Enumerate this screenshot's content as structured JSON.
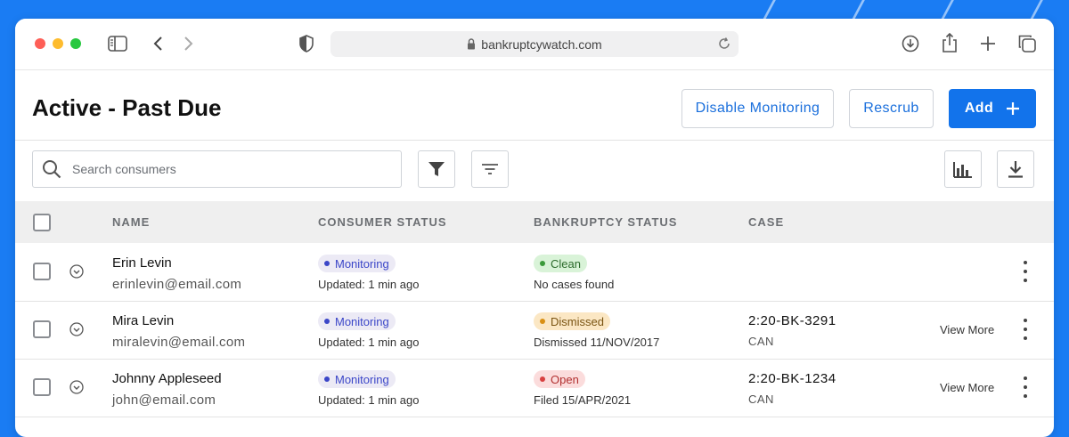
{
  "browser": {
    "url": "bankruptcywatch.com"
  },
  "page": {
    "title": "Active - Past Due",
    "buttons": {
      "disable_monitoring": "Disable Monitoring",
      "rescrub": "Rescrub",
      "add": "Add"
    },
    "search": {
      "placeholder": "Search consumers",
      "value": ""
    }
  },
  "table": {
    "headers": {
      "name": "NAME",
      "consumer_status": "CONSUMER STATUS",
      "bankruptcy_status": "BANKRUPTCY STATUS",
      "case": "CASE"
    },
    "rows": [
      {
        "name": "Erin Levin",
        "email": "erinlevin@email.com",
        "consumer_status": "Monitoring",
        "consumer_updated": "Updated: 1 min ago",
        "bankruptcy_status": "Clean",
        "bankruptcy_detail": "No cases found",
        "case_number": "",
        "case_type": "",
        "view_more": ""
      },
      {
        "name": "Mira Levin",
        "email": "miralevin@email.com",
        "consumer_status": "Monitoring",
        "consumer_updated": "Updated: 1 min ago",
        "bankruptcy_status": "Dismissed",
        "bankruptcy_detail": "Dismissed 11/NOV/2017",
        "case_number": "2:20-BK-3291",
        "case_type": "CAN",
        "view_more": "View More"
      },
      {
        "name": "Johnny Appleseed",
        "email": "john@email.com",
        "consumer_status": "Monitoring",
        "consumer_updated": "Updated: 1 min ago",
        "bankruptcy_status": "Open",
        "bankruptcy_detail": "Filed 15/APR/2021",
        "case_number": "2:20-BK-1234",
        "case_type": "CAN",
        "view_more": "View More"
      }
    ]
  },
  "colors": {
    "background": "#1a7cf3",
    "primary": "#1273eb",
    "monitoring_bg": "#eceaf5",
    "monitoring_text": "#3b46c8",
    "clean_bg": "#d9f3d8",
    "clean_text": "#2c6b2c",
    "dismissed_bg": "#fbe7c4",
    "dismissed_text": "#7a5412",
    "open_bg": "#fbdcdc",
    "open_text": "#b23030"
  },
  "icons": [
    "sidebar-icon",
    "back-icon",
    "forward-icon",
    "shield-icon",
    "lock-icon",
    "reload-icon",
    "download-icon",
    "share-icon",
    "new-tab-icon",
    "tabs-icon",
    "search-icon",
    "filter-icon",
    "sort-icon",
    "chart-icon",
    "export-icon",
    "plus-icon",
    "chevron-down-icon",
    "kebab-icon"
  ]
}
